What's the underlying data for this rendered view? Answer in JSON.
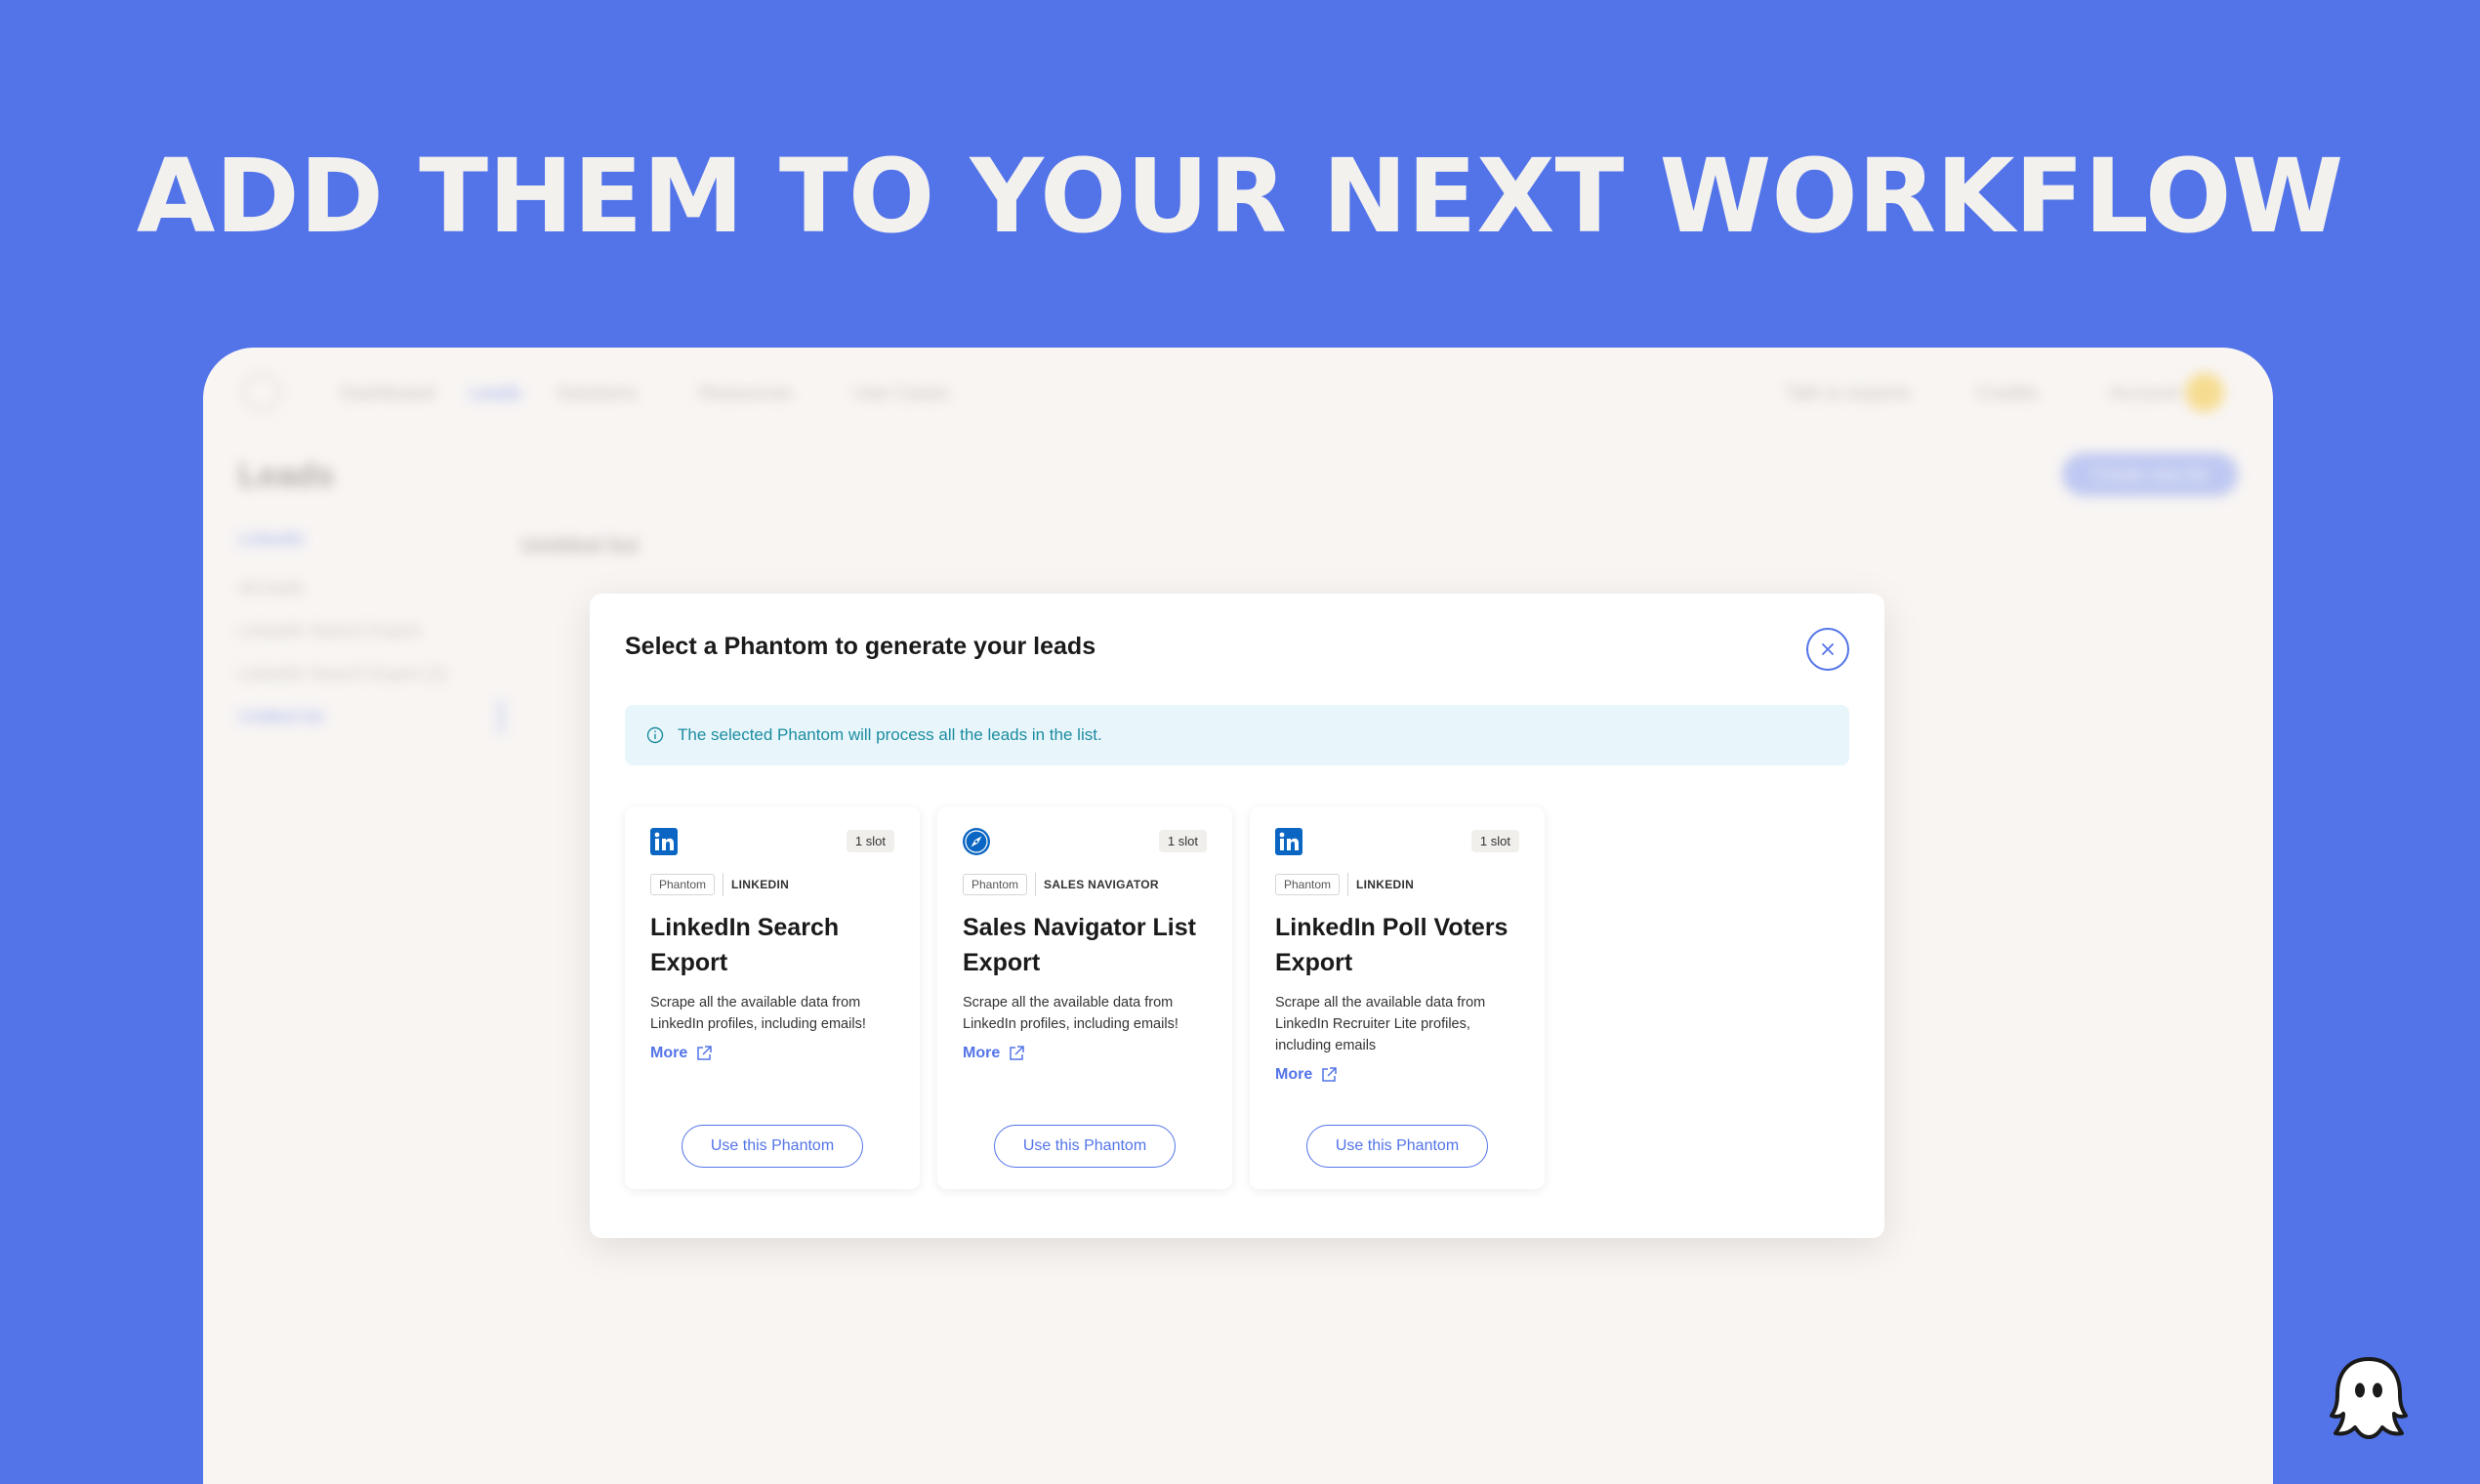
{
  "headline": "ADD THEM TO YOUR NEXT WORKFLOW",
  "background_app": {
    "nav_items": [
      "Dashboard",
      "Leads",
      "Solutions",
      "Resources",
      "Use Cases"
    ],
    "nav_right": [
      "Talk to experts",
      "Credits",
      "Account"
    ],
    "page_title": "Leads",
    "create_button": "Create new list",
    "sidebar_items": [
      "LinkedIn",
      "All leads",
      "LinkedIn Search Export",
      "LinkedIn Search Export (2)",
      "Untitled list"
    ],
    "list_title": "Untitled list"
  },
  "modal": {
    "title": "Select a Phantom to generate your leads",
    "info_text": "The selected Phantom will process all the leads in the list.",
    "cards": [
      {
        "icon": "linkedin-icon",
        "slot": "1 slot",
        "tag_type": "Phantom",
        "tag_platform": "LINKEDIN",
        "title": "LinkedIn Search Export",
        "description": "Scrape all the available data from LinkedIn profiles, including emails!",
        "more_label": "More",
        "button_label": "Use this Phantom"
      },
      {
        "icon": "compass-icon",
        "slot": "1 slot",
        "tag_type": "Phantom",
        "tag_platform": "SALES NAVIGATOR",
        "title": "Sales Navigator List Export",
        "description": "Scrape all the available data from LinkedIn profiles, including emails!",
        "more_label": "More",
        "button_label": "Use this Phantom"
      },
      {
        "icon": "linkedin-icon",
        "slot": "1 slot",
        "tag_type": "Phantom",
        "tag_platform": "LINKEDIN",
        "title": "LinkedIn Poll Voters Export",
        "description": "Scrape all the available data from LinkedIn Recruiter Lite profiles, including emails",
        "more_label": "More",
        "button_label": "Use this Phantom"
      }
    ]
  },
  "colors": {
    "background": "#5374E8",
    "accent": "#5374E8",
    "linkedin": "#0A66C2",
    "info_bg": "#E8F6FB",
    "info_text": "#1C8CA0"
  }
}
